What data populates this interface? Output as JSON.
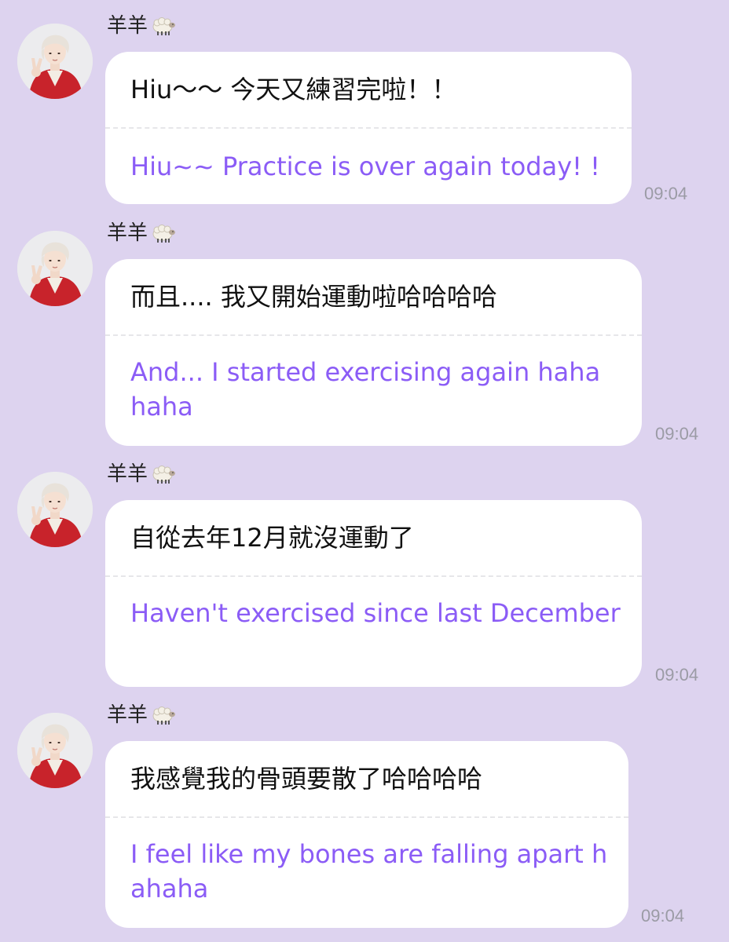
{
  "messages": [
    {
      "sender": "羊羊",
      "sender_icon": "sheep-emoji",
      "original": "Hiu～～ 今天又練習完啦！！",
      "translation": "Hiu~~ Practice is over again today! !",
      "time": "09:04"
    },
    {
      "sender": "羊羊",
      "sender_icon": "sheep-emoji",
      "original": "而且.... 我又開始運動啦哈哈哈哈",
      "translation": "And... I started exercising again haha haha",
      "time": "09:04"
    },
    {
      "sender": "羊羊",
      "sender_icon": "sheep-emoji",
      "original": "自從去年12月就沒運動了",
      "translation": "Haven't exercised since last December",
      "time": "09:04"
    },
    {
      "sender": "羊羊",
      "sender_icon": "sheep-emoji",
      "original": "我感覺我的骨頭要散了哈哈哈哈",
      "translation": "I feel like my bones are falling apart hahaha",
      "time": "09:04"
    }
  ],
  "colors": {
    "background": "#ddd3ef",
    "bubble": "#ffffff",
    "translation_text": "#8b5cf6",
    "time_text": "#9b9ba5"
  }
}
